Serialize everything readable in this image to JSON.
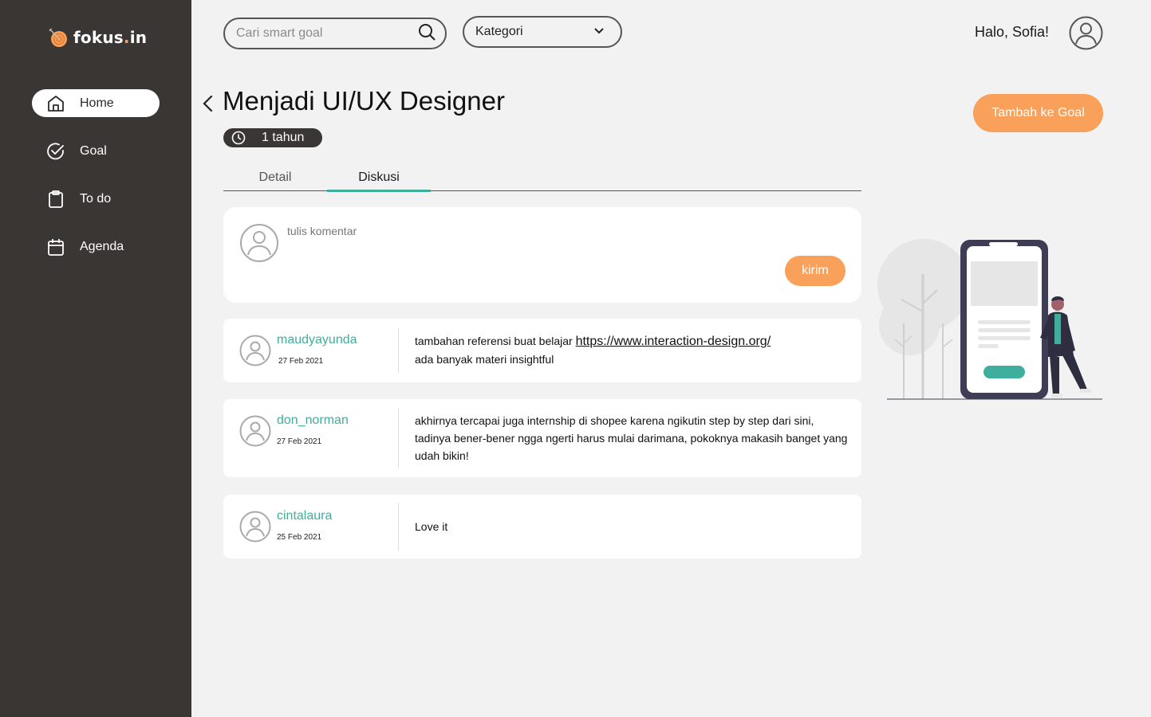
{
  "app": {
    "logo_name": "fokus",
    "logo_dot": ".",
    "logo_suffix": "in"
  },
  "sidebar": {
    "items": [
      {
        "label": "Home",
        "icon": "home-icon",
        "active": true
      },
      {
        "label": "Goal",
        "icon": "check-circle-icon",
        "active": false
      },
      {
        "label": "To do",
        "icon": "clipboard-icon",
        "active": false
      },
      {
        "label": "Agenda",
        "icon": "calendar-icon",
        "active": false
      }
    ]
  },
  "header": {
    "search_placeholder": "Cari smart goal",
    "category_label": "Kategori",
    "greeting": "Halo, Sofia!"
  },
  "goal": {
    "title": "Menjadi UI/UX Designer",
    "duration": "1 tahun",
    "add_button": "Tambah ke Goal"
  },
  "tabs": [
    {
      "label": "Detail",
      "active": false
    },
    {
      "label": "Diskusi",
      "active": true
    }
  ],
  "compose": {
    "placeholder": "tulis komentar",
    "send_label": "kirim"
  },
  "comments": [
    {
      "user": "maudyayunda",
      "date": "27 Feb 2021",
      "text_before": "tambahan referensi buat belajar ",
      "link": "https://www.interaction-design.org/",
      "text_after": "ada banyak materi insightful"
    },
    {
      "user": "don_norman",
      "date": "27 Feb 2021",
      "text": "akhirnya tercapai juga internship di shopee karena ngikutin step by step dari sini, tadinya bener-bener ngga ngerti harus mulai darimana, pokoknya makasih banget yang udah bikin!"
    },
    {
      "user": "cintalaura",
      "date": "25 Feb 2021",
      "text": "Love it"
    }
  ],
  "colors": {
    "sidebar": "#3a3633",
    "accent_orange": "#f9a05a",
    "accent_teal": "#3fae9d",
    "background": "#f2f2f2"
  }
}
